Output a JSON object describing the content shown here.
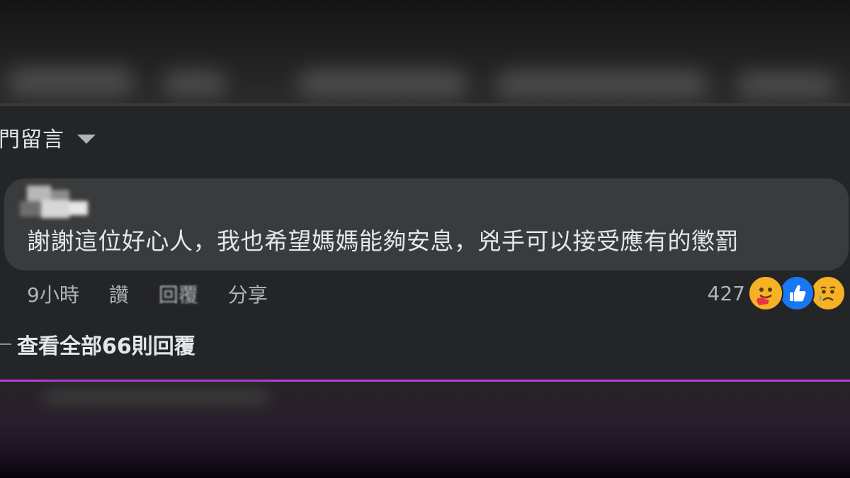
{
  "comments_header": {
    "label": "門留言"
  },
  "comment": {
    "text": "謝謝這位好心人，我也希望媽媽能夠安息，兇手可以接受應有的懲罰",
    "time": "9小時",
    "like_label": "讚",
    "reply_label": "回覆",
    "share_label": "分享",
    "reaction_count": "427",
    "reactions": [
      "care-icon",
      "like-icon",
      "sad-icon"
    ]
  },
  "view_replies": {
    "label": "查看全部66則回覆"
  },
  "colors": {
    "background": "#242526",
    "bubble": "#3a3b3c",
    "divider": "#b33fd9",
    "like_blue": "#1877f2",
    "emoji_yellow": "#f7b125"
  }
}
